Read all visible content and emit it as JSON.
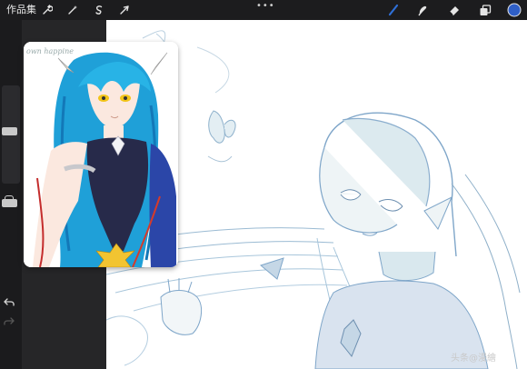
{
  "topbar": {
    "gallery_label": "作品集",
    "left_tools": [
      "wrench-icon",
      "magic-wand-icon",
      "selection-icon",
      "transform-arrow-icon"
    ],
    "right_tools": [
      "brush-icon",
      "smudge-icon",
      "eraser-icon",
      "layers-icon",
      "color-swatch-icon"
    ],
    "more_label": "•••"
  },
  "colors": {
    "toolbar_bg": "#1c1c1e",
    "active_tool": "#2f6fd6",
    "current_color": "#2f5fc7",
    "sketch_line": "#7fa6c9",
    "sketch_fill": "#d9e8ee"
  },
  "reference": {
    "caption": "own happine"
  },
  "watermark": "头条@漫繪"
}
